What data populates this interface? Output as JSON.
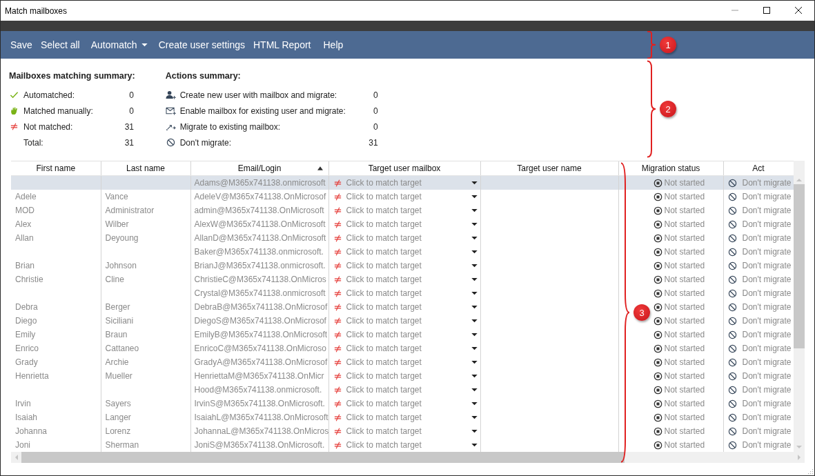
{
  "window": {
    "title": "Match mailboxes"
  },
  "toolbar": [
    {
      "label": "Save",
      "kind": "plain"
    },
    {
      "label": "Select all",
      "kind": "plain"
    },
    {
      "label": "Automatch",
      "kind": "dropdown"
    },
    {
      "label": "Create user settings",
      "kind": "plain"
    },
    {
      "label": "HTML Report",
      "kind": "plain"
    },
    {
      "label": "Help",
      "kind": "plain"
    }
  ],
  "matching_summary": {
    "title": "Mailboxes matching summary:",
    "items": [
      {
        "label": "Automatched:",
        "value": "0",
        "kind": "check"
      },
      {
        "label": "Matched manually:",
        "value": "0",
        "kind": "hand"
      },
      {
        "label": "Not matched:",
        "value": "31",
        "kind": "notequal"
      },
      {
        "label": "Total:",
        "value": "31",
        "kind": "none"
      }
    ]
  },
  "actions_summary": {
    "title": "Actions summary:",
    "items": [
      {
        "label": "Create new user with mailbox and migrate:",
        "value": "0",
        "kind": "user-plus"
      },
      {
        "label": "Enable mailbox for existing user and migrate:",
        "value": "0",
        "kind": "mail-plus"
      },
      {
        "label": "Migrate to existing mailbox:",
        "value": "0",
        "kind": "migrate"
      },
      {
        "label": "Don't migrate:",
        "value": "31",
        "kind": "block"
      }
    ]
  },
  "table": {
    "columns": [
      {
        "label": "First name"
      },
      {
        "label": "Last name"
      },
      {
        "label": "Email/Login",
        "sorted": true
      },
      {
        "label": "Target user mailbox"
      },
      {
        "label": "Target user name"
      },
      {
        "label": "Migration status"
      },
      {
        "label": "Act"
      }
    ],
    "rows": [
      {
        "selected": true,
        "first": "",
        "last": "",
        "email": "Adams@M365x741138.onmicrosoft",
        "target": "Click to match target",
        "status": "Not started",
        "action": "Don't migrate"
      },
      {
        "selected": false,
        "first": "Adele",
        "last": "Vance",
        "email": "AdeleV@M365x741138.OnMicrosof",
        "target": "Click to match target",
        "status": "Not started",
        "action": "Don't migrate"
      },
      {
        "selected": false,
        "first": "MOD",
        "last": "Administrator",
        "email": "admin@M365x741138.OnMicrosoft",
        "target": "Click to match target",
        "status": "Not started",
        "action": "Don't migrate"
      },
      {
        "selected": false,
        "first": "Alex",
        "last": "Wilber",
        "email": "AlexW@M365x741138.OnMicrosoft",
        "target": "Click to match target",
        "status": "Not started",
        "action": "Don't migrate"
      },
      {
        "selected": false,
        "first": "Allan",
        "last": "Deyoung",
        "email": "AllanD@M365x741138.OnMicrosoft",
        "target": "Click to match target",
        "status": "Not started",
        "action": "Don't migrate"
      },
      {
        "selected": false,
        "first": "",
        "last": "",
        "email": "Baker@M365x741138.onmicrosoft.",
        "target": "Click to match target",
        "status": "Not started",
        "action": "Don't migrate"
      },
      {
        "selected": false,
        "first": "Brian",
        "last": "Johnson",
        "email": "BrianJ@M365x741138.onmicrosoft.",
        "target": "Click to match target",
        "status": "Not started",
        "action": "Don't migrate"
      },
      {
        "selected": false,
        "first": "Christie",
        "last": "Cline",
        "email": "ChristieC@M365x741138.OnMicros",
        "target": "Click to match target",
        "status": "Not started",
        "action": "Don't migrate"
      },
      {
        "selected": false,
        "first": "",
        "last": "",
        "email": "Crystal@M365x741138.onmicrosoft",
        "target": "Click to match target",
        "status": "Not started",
        "action": "Don't migrate"
      },
      {
        "selected": false,
        "first": "Debra",
        "last": "Berger",
        "email": "DebraB@M365x741138.OnMicrosof",
        "target": "Click to match target",
        "status": "Not started",
        "action": "Don't migrate"
      },
      {
        "selected": false,
        "first": "Diego",
        "last": "Siciliani",
        "email": "DiegoS@M365x741138.OnMicrosof",
        "target": "Click to match target",
        "status": "Not started",
        "action": "Don't migrate"
      },
      {
        "selected": false,
        "first": "Emily",
        "last": "Braun",
        "email": "EmilyB@M365x741138.OnMicrosoft",
        "target": "Click to match target",
        "status": "Not started",
        "action": "Don't migrate"
      },
      {
        "selected": false,
        "first": "Enrico",
        "last": "Cattaneo",
        "email": "EnricoC@M365x741138.OnMicroso",
        "target": "Click to match target",
        "status": "Not started",
        "action": "Don't migrate"
      },
      {
        "selected": false,
        "first": "Grady",
        "last": "Archie",
        "email": "GradyA@M365x741138.OnMicrosof",
        "target": "Click to match target",
        "status": "Not started",
        "action": "Don't migrate"
      },
      {
        "selected": false,
        "first": "Henrietta",
        "last": "Mueller",
        "email": "HenriettaM@M365x741138.OnMicr",
        "target": "Click to match target",
        "status": "Not started",
        "action": "Don't migrate"
      },
      {
        "selected": false,
        "first": "",
        "last": "",
        "email": "Hood@M365x741138.onmicrosoft.",
        "target": "Click to match target",
        "status": "Not started",
        "action": "Don't migrate"
      },
      {
        "selected": false,
        "first": "Irvin",
        "last": "Sayers",
        "email": "IrvinS@M365x741138.OnMicrosoft.",
        "target": "Click to match target",
        "status": "Not started",
        "action": "Don't migrate"
      },
      {
        "selected": false,
        "first": "Isaiah",
        "last": "Langer",
        "email": "IsaiahL@M365x741138.OnMicrosoft",
        "target": "Click to match target",
        "status": "Not started",
        "action": "Don't migrate"
      },
      {
        "selected": false,
        "first": "Johanna",
        "last": "Lorenz",
        "email": "JohannaL@M365x741138.OnMicros",
        "target": "Click to match target",
        "status": "Not started",
        "action": "Don't migrate"
      },
      {
        "selected": false,
        "first": "Joni",
        "last": "Sherman",
        "email": "JoniS@M365x741138.OnMicrosoft.",
        "target": "Click to match target",
        "status": "Not started",
        "action": "Don't migrate"
      }
    ]
  },
  "callouts": [
    "1",
    "2",
    "3"
  ]
}
